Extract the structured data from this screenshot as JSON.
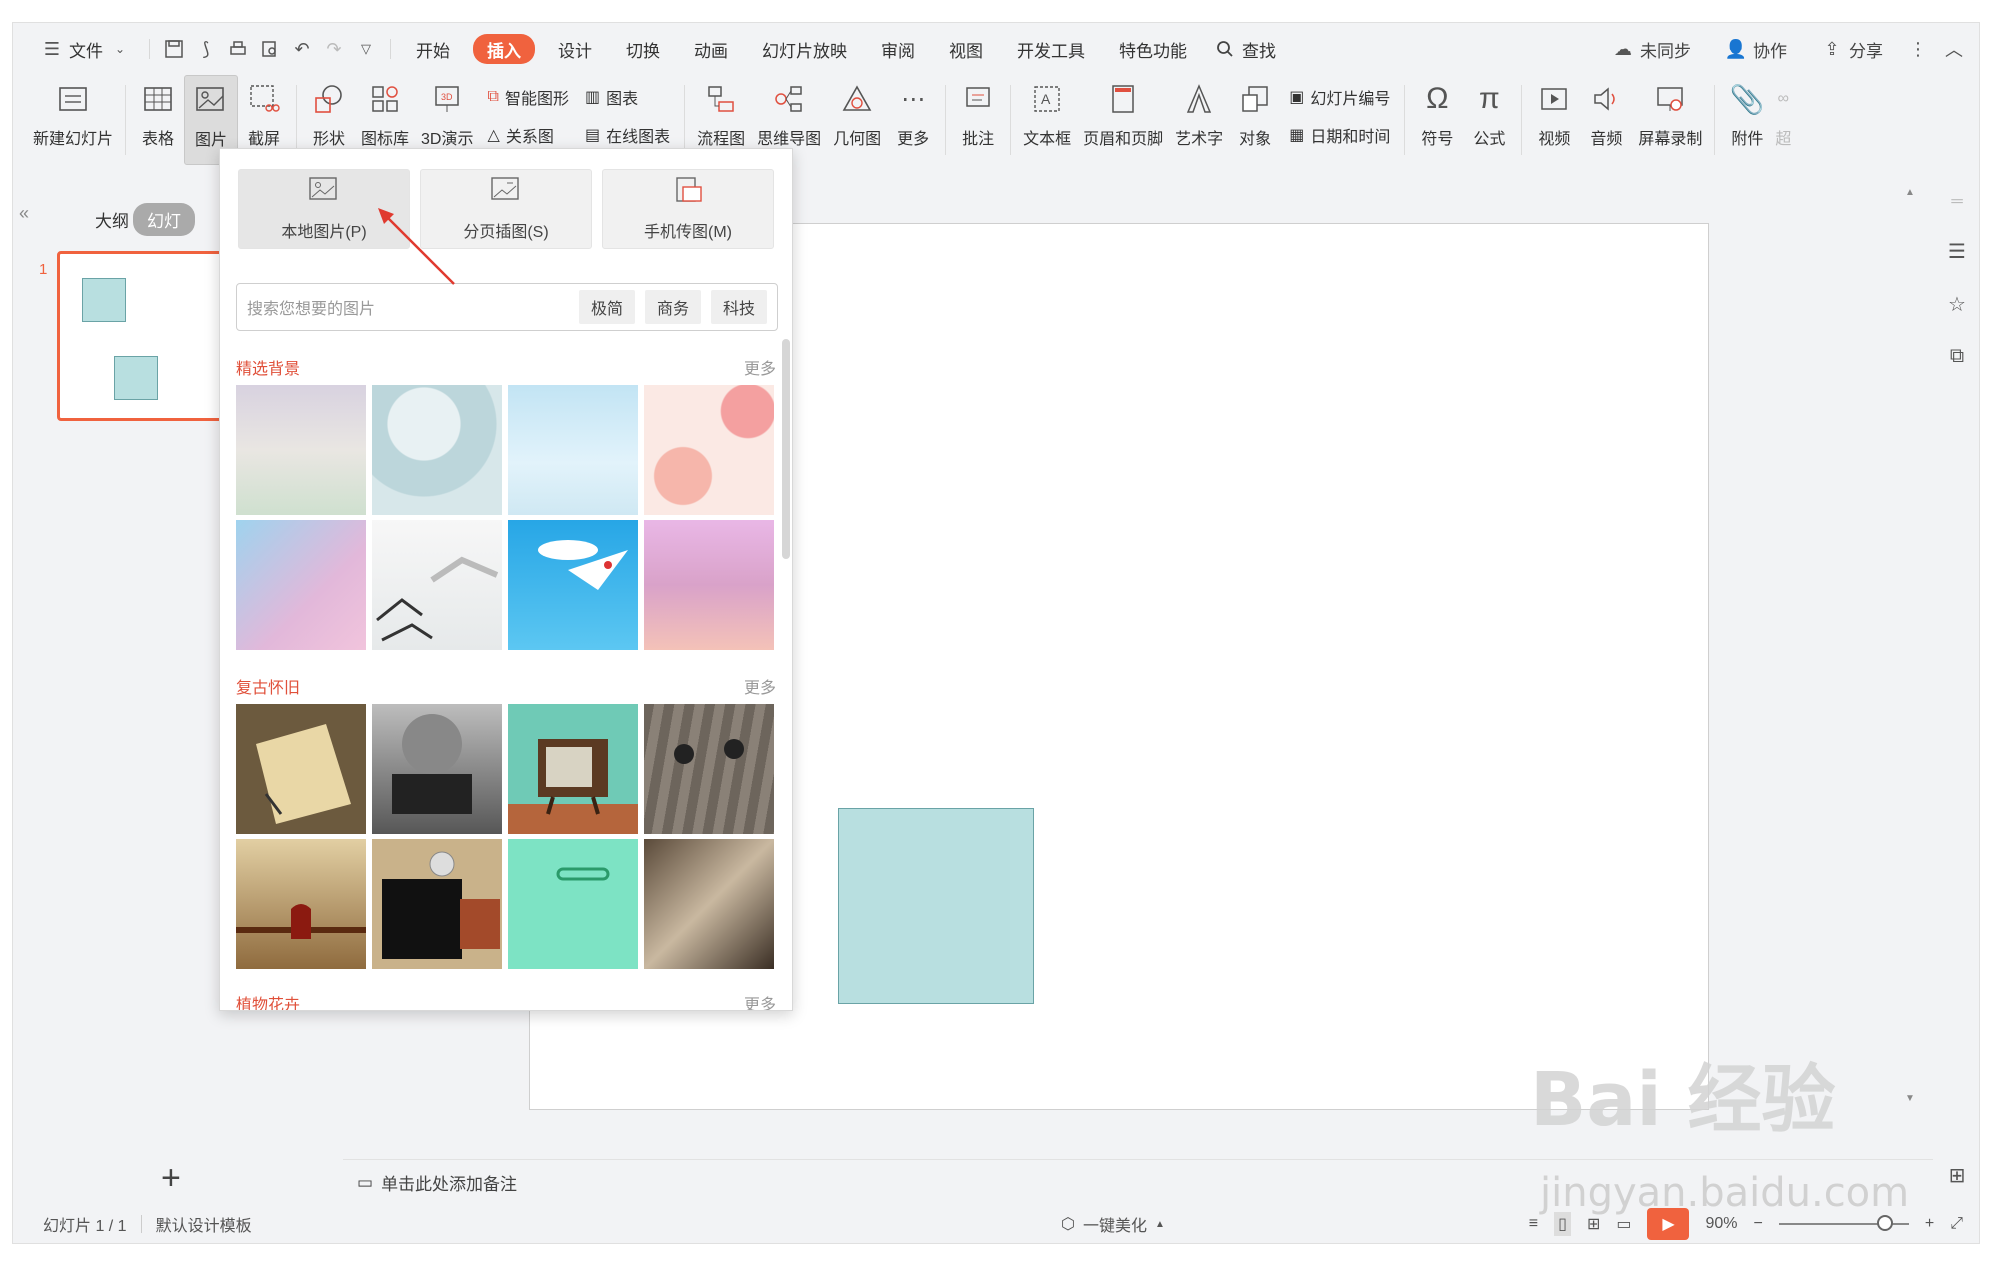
{
  "menubar": {
    "file_label": "文件",
    "tabs": [
      {
        "label": "开始"
      },
      {
        "label": "插入",
        "active": true
      },
      {
        "label": "设计"
      },
      {
        "label": "切换"
      },
      {
        "label": "动画"
      },
      {
        "label": "幻灯片放映"
      },
      {
        "label": "审阅"
      },
      {
        "label": "视图"
      },
      {
        "label": "开发工具"
      },
      {
        "label": "特色功能"
      }
    ],
    "search_label": "查找",
    "sync_label": "未同步",
    "collab_label": "协作",
    "share_label": "分享"
  },
  "ribbon": {
    "new_slide": "新建幻灯片",
    "table": "表格",
    "picture": "图片",
    "screenshot": "截屏",
    "shape": "形状",
    "icon_lib": "图标库",
    "three_d": "3D演示",
    "smart_art": "智能图形",
    "relation": "关系图",
    "chart": "图表",
    "online_chart": "在线图表",
    "flowchart": "流程图",
    "mindmap": "思维导图",
    "geometry": "几何图",
    "more": "更多",
    "comment": "批注",
    "textbox": "文本框",
    "header_footer": "页眉和页脚",
    "word_art": "艺术字",
    "object": "对象",
    "slide_number": "幻灯片编号",
    "date_time": "日期和时间",
    "symbol": "符号",
    "formula": "公式",
    "video": "视频",
    "audio": "音频",
    "screen_record": "屏幕录制",
    "attachment": "附件",
    "hyperlink_partial": "超"
  },
  "left_panel": {
    "outline_tab": "大纲",
    "slides_tab": "幻灯",
    "slide_number": "1"
  },
  "dropdown": {
    "local_picture": "本地图片(P)",
    "paged_insert": "分页插图(S)",
    "phone_transfer": "手机传图(M)",
    "search_placeholder": "搜索您想要的图片",
    "chips": [
      "极简",
      "商务",
      "科技"
    ],
    "section1_title": "精选背景",
    "section2_title": "复古怀旧",
    "section3_title": "植物花卉",
    "more": "更多"
  },
  "notes": {
    "placeholder": "单击此处添加备注"
  },
  "status": {
    "slide_info": "幻灯片 1 / 1",
    "template": "默认设计模板",
    "beautify": "一键美化",
    "zoom": "90%"
  },
  "watermark": {
    "text": "Bai 经验",
    "url_text": "jingyan.baidu.com"
  },
  "colors": {
    "accent": "#f0623e",
    "shape_fill": "#b8dfe0",
    "shape_border": "#6aa3a6"
  }
}
